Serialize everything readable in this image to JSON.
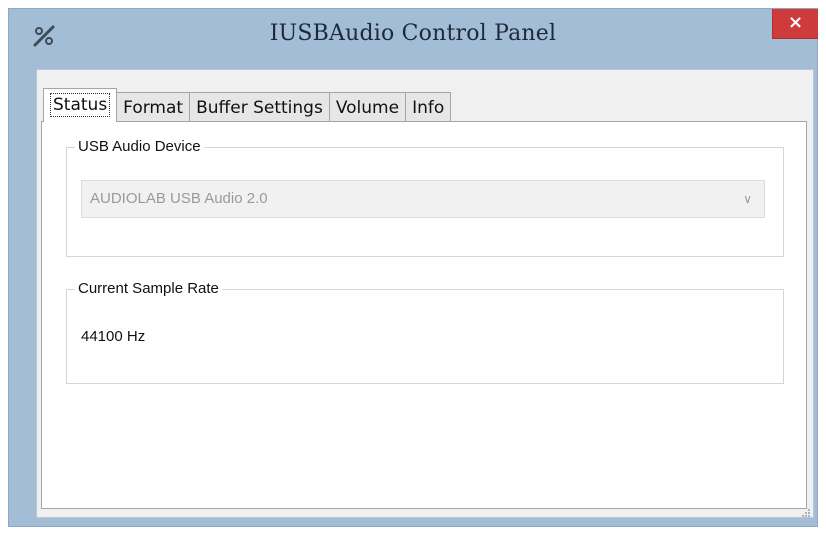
{
  "window": {
    "title": "IUSBAudio Control Panel",
    "close_label": "×"
  },
  "tabs": [
    {
      "label": "Status",
      "active": true
    },
    {
      "label": "Format",
      "active": false
    },
    {
      "label": "Buffer Settings",
      "active": false
    },
    {
      "label": "Volume",
      "active": false
    },
    {
      "label": "Info",
      "active": false
    }
  ],
  "status": {
    "device_group": {
      "legend": "USB Audio Device",
      "selected_device": "AUDIOLAB USB Audio 2.0",
      "disabled": true
    },
    "rate_group": {
      "legend": "Current Sample Rate",
      "value": "44100 Hz"
    }
  },
  "colors": {
    "frame": "#a4bdd6",
    "close_button": "#cf3a3a",
    "client_background": "#f0f0f0",
    "panel_background": "#ffffff"
  },
  "icons": {
    "app": "app-icon",
    "close": "close-icon",
    "dropdown": "chevron-down-icon",
    "resize": "resize-grip-icon"
  }
}
